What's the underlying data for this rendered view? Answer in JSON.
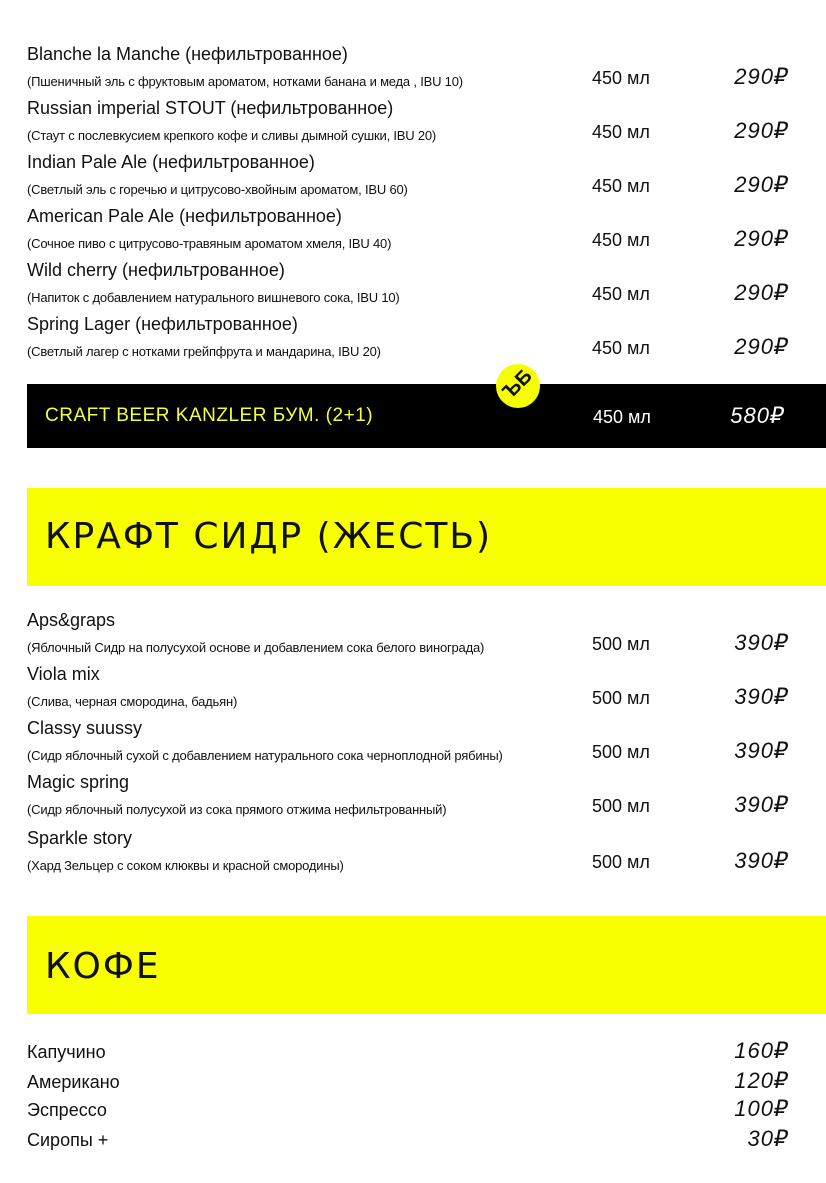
{
  "beer": [
    {
      "name": "Blanche la Manche (нефильтрованное)",
      "desc": "(Пшеничный эль с фруктовым ароматом, нотками банана и меда , IBU 10)",
      "volume": "450 мл",
      "price": "290₽"
    },
    {
      "name": "Russian imperial STOUT (нефильтрованное)",
      "desc": "(Стаут с послевкусием крепкого кофе и сливы дымной сушки, IBU 20)",
      "volume": "450 мл",
      "price": "290₽"
    },
    {
      "name": "Indian Pale Ale (нефильтрованное)",
      "desc": "(Светлый эль с горечью и цитрусово-хвойным ароматом, IBU 60)",
      "volume": "450 мл",
      "price": "290₽"
    },
    {
      "name": "American Pale Ale (нефильтрованное)",
      "desc": "(Сочное пиво с цитрусово-травяным ароматом хмеля, IBU 40)",
      "volume": "450 мл",
      "price": "290₽"
    },
    {
      "name": "Wild cherry (нефильтрованное)",
      "desc": "(Напиток с добавлением натурального вишневого сока, IBU 10)",
      "volume": "450 мл",
      "price": "290₽"
    },
    {
      "name": "Spring Lager (нефильтрованное)",
      "desc": "(Светлый лагер  с нотками грейпфрута и мандарина, IBU 20)",
      "volume": "450 мл",
      "price": "290₽"
    }
  ],
  "promo": {
    "badge": "ЪБ",
    "title": "CRAFT BEER KANZLER БУМ. (2+1)",
    "volume": "450 мл",
    "price": "580₽"
  },
  "cider_section": {
    "title": "КРАФТ СИДР (ЖЕСТЬ)"
  },
  "cider": [
    {
      "name": "Aps&graps",
      "desc": "(Яблочный Сидр на полусухой основе и добавлением сока белого винограда)",
      "volume": "500 мл",
      "price": "390₽"
    },
    {
      "name": "Viola mix",
      "desc": "(Слива, черная смородина, бадьян)",
      "volume": "500 мл",
      "price": "390₽"
    },
    {
      "name": "Classy suussy",
      "desc": "(Сидр яблочный сухой с добавлением натурального сока черноплодной рябины)",
      "volume": "500 мл",
      "price": "390₽"
    },
    {
      "name": "Magic spring",
      "desc": "(Сидр яблочный полусухой из сока прямого отжима нефильтрованный)",
      "volume": "500 мл",
      "price": "390₽"
    },
    {
      "name": "Sparkle story",
      "desc": "(Хард Зельцер с соком клюквы и красной смородины)",
      "volume": "500 мл",
      "price": "390₽"
    }
  ],
  "coffee_section": {
    "title": "КОФЕ"
  },
  "coffee": [
    {
      "name": "Капучино",
      "price": "160₽"
    },
    {
      "name": "Американо",
      "price": "120₽"
    },
    {
      "name": "Эспрессо",
      "price": "100₽"
    },
    {
      "name": "Сиропы +",
      "price": "30₽"
    }
  ],
  "colors": {
    "accent_yellow": "#f7ff00",
    "promo_text": "#f5ff3a",
    "promo_bg": "#000000"
  }
}
